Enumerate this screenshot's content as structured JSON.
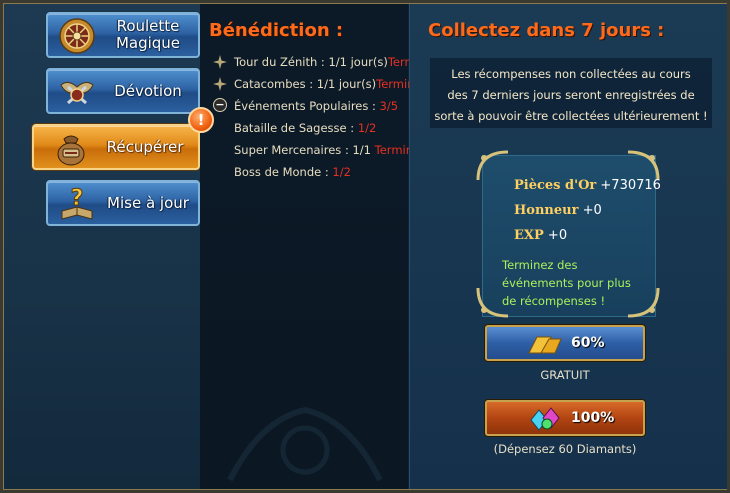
{
  "nav": {
    "items": [
      {
        "label": "Roulette\nMagique",
        "icon": "roulette-wheel-icon"
      },
      {
        "label": "Dévotion",
        "icon": "winged-emblem-icon"
      },
      {
        "label": "Récupérer",
        "icon": "treasure-bag-icon",
        "active": true
      },
      {
        "label": "Mise à jour",
        "icon": "question-book-icon"
      }
    ],
    "alert_badge": "!"
  },
  "benediction": {
    "title": "Bénédiction :",
    "rows": [
      {
        "icon": "sparkle-icon",
        "label": "Tour du Zénith : ",
        "progress": "1/1 jour(s)",
        "status": "Terminé"
      },
      {
        "icon": "sparkle-icon",
        "label": "Catacombes : ",
        "progress": "1/1 jour(s)",
        "status": "Terminé"
      },
      {
        "icon": "collapse-icon",
        "label": "Événements Populaires : ",
        "progress": "3/5",
        "status": ""
      },
      {
        "icon": "",
        "label": "Bataille de Sagesse : ",
        "progress": "1/2",
        "status": ""
      },
      {
        "icon": "",
        "label": "Super Mercenaires : ",
        "progress": "1/1",
        "status": "Terminé"
      },
      {
        "icon": "",
        "label": "Boss de Monde : ",
        "progress": "1/2",
        "status": ""
      }
    ]
  },
  "collect": {
    "title": "Collectez dans 7 jours :",
    "info_lines": [
      "Les récompenses non collectées au cours",
      "des 7 derniers jours seront enregistrées de",
      "sorte à pouvoir être collectées ultérieurement !"
    ],
    "rewards": [
      {
        "name": "Pièces d'Or",
        "value": "+730716"
      },
      {
        "name": "Honneur",
        "value": "+0"
      },
      {
        "name": "EXP",
        "value": "+0"
      }
    ],
    "encourage_lines": [
      "Terminez des",
      "événements pour plus",
      "de récompenses !"
    ],
    "free_button": {
      "percent": "60%",
      "caption": "GRATUIT",
      "icon": "gold-bars-icon"
    },
    "paid_button": {
      "percent": "100%",
      "caption": "(Dépensez 60 Diamants)",
      "icon": "gems-icon"
    }
  }
}
